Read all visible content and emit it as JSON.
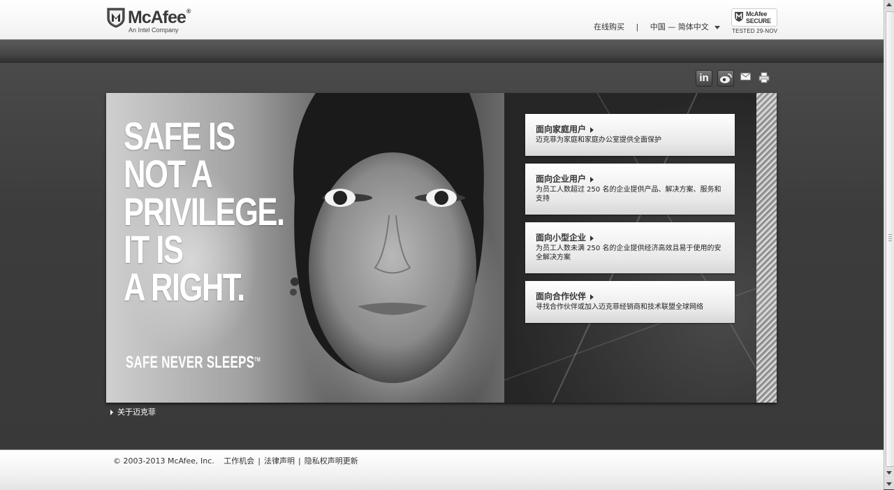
{
  "header": {
    "logo_text": "McAfee",
    "logo_reg": "®",
    "logo_tagline": "An Intel Company",
    "nav": {
      "buy_online": "在线购买",
      "separator": "|",
      "region": "中国 — 简体中文"
    },
    "secure_badge": {
      "line1": "McAfee",
      "line2": "SECURE",
      "tested": "TESTED 29-NOV"
    }
  },
  "share": {
    "linkedin_label": "in",
    "icons": [
      "linkedin-icon",
      "weibo-icon",
      "mail-icon",
      "print-icon"
    ]
  },
  "hero": {
    "headline": "SAFE IS\nNOT A\nPRIVILEGE.\nIT IS\nA RIGHT.",
    "tagline": "SAFE NEVER SLEEPS",
    "tagline_tm": "TM",
    "cards": [
      {
        "title": "面向家庭用户",
        "desc": "迈克菲为家庭和家庭办公室提供全面保护"
      },
      {
        "title": "面向企业用户",
        "desc": "为员工人数超过 250 名的企业提供产品、解决方案、服务和支持"
      },
      {
        "title": "面向小型企业",
        "desc": "为员工人数未满 250 名的企业提供经济高效且易于使用的安全解决方案"
      },
      {
        "title": "面向合作伙伴",
        "desc": "寻找合作伙伴或加入迈克菲经销商和技术联盟全球网络"
      }
    ]
  },
  "about_link": "关于迈克菲",
  "footer": {
    "copyright": "© 2003-2013 McAfee, Inc.",
    "links": [
      "工作机会",
      "法律声明",
      "隐私权声明更新"
    ],
    "separator": "|"
  },
  "colors": {
    "background": "#3a3a3a",
    "header_bg": "#ffffff",
    "card_bg": "#f0f0f0",
    "text_dark": "#333333"
  }
}
